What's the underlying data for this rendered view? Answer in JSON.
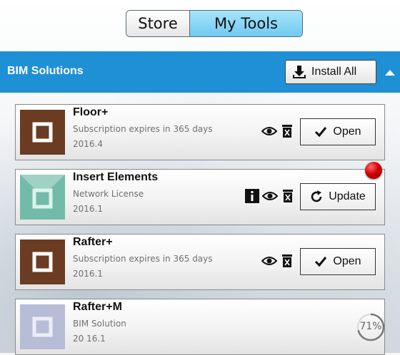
{
  "toggle": {
    "store_label": "Store",
    "tools_label": "My Tools",
    "selected": "My Tools"
  },
  "section": {
    "title": "BIM Solutions",
    "install_all_label": "Install All"
  },
  "colors": {
    "header": "#1f8fd6",
    "toggle_active": "#7fd0f3",
    "notification": "#d30000"
  },
  "tools": [
    {
      "name": "Floor+",
      "subtitle": "Subscription expires in 365 days",
      "version": "2016.4",
      "action": "Open",
      "action_icon": "check-icon",
      "thumb_color": "#6b3b22"
    },
    {
      "name": "Insert Elements",
      "subtitle": "Network License",
      "version": "2016.1",
      "action": "Update",
      "action_icon": "refresh-icon",
      "thumb_color": "#72bba9",
      "has_info": true,
      "has_notification": true
    },
    {
      "name": "Rafter+",
      "subtitle": "Subscription expires in 365 days",
      "version": "2016.1",
      "action": "Open",
      "action_icon": "check-icon",
      "thumb_color": "#6b3b22"
    },
    {
      "name": "Rafter+M",
      "subtitle": "BIM Solution",
      "version": "20 16.1",
      "progress_label": "71%",
      "progress": 0.71,
      "thumb_color": "#b7bdd6"
    }
  ]
}
